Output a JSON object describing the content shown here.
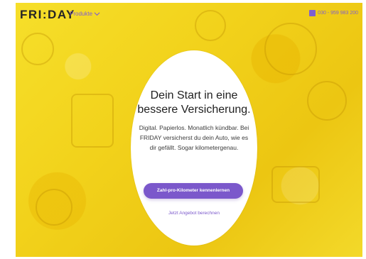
{
  "header": {
    "logo_text": "FRI:DAY",
    "products_label": "Produkte",
    "phone_number": "030 - 959 983 200"
  },
  "hero": {
    "headline": "Dein Start in eine bessere Versicherung.",
    "subtext": "Digital. Papierlos. Monatlich kündbar. Bei FRIDAY versicherst du dein Auto, wie es dir gefällt. Sogar kilometergenau.",
    "primary_button_label": "Zahl-pro-Kilometer kennenlernen",
    "secondary_link_label": "Jetzt Angebot berechnen"
  },
  "icons": {
    "products_chevron": "chevron-down-icon",
    "phone": "phone-icon"
  },
  "colors": {
    "hero_yellow": "#f2d21b",
    "accent_purple": "#7b58cb",
    "text_dark": "#1f1f1f"
  }
}
